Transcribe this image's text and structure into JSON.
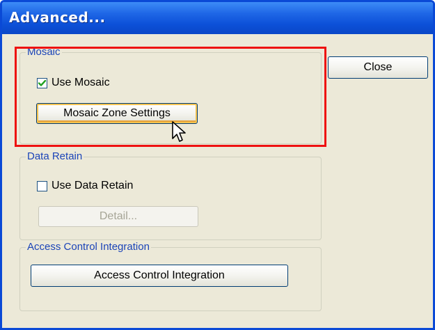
{
  "window": {
    "title": "Advanced...",
    "colors": {
      "titlebar": "#0c50d8",
      "dialog": "#ece9d8",
      "highlight": "#ee1111",
      "group_label": "#1b44b8"
    }
  },
  "buttons": {
    "close_label": "Close"
  },
  "mosaic": {
    "group_label": "Mosaic",
    "use_mosaic_label": "Use Mosaic",
    "use_mosaic_checked": true,
    "zone_settings_label": "Mosaic Zone Settings"
  },
  "data_retain": {
    "group_label": "Data Retain",
    "use_data_retain_label": "Use Data Retain",
    "use_data_retain_checked": false,
    "detail_label": "Detail..."
  },
  "access_control": {
    "group_label": "Access Control Integration",
    "button_label": "Access Control Integration"
  },
  "icons": [
    "checkmark-icon",
    "mouse-cursor-icon"
  ]
}
